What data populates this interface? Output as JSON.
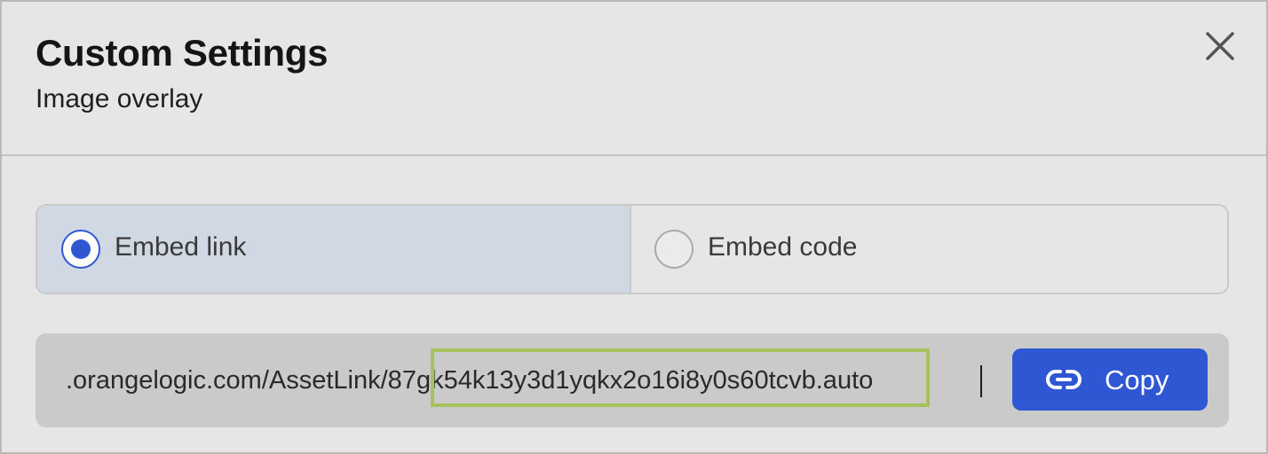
{
  "dialog": {
    "title": "Custom Settings",
    "subtitle": "Image overlay",
    "close_icon": "close-icon"
  },
  "embed_options": {
    "selected": "Embed link",
    "options": [
      {
        "label": "Embed link",
        "selected": true
      },
      {
        "label": "Embed code",
        "selected": false
      }
    ]
  },
  "link": {
    "value": ".orangelogic.com/AssetLink/87gk54k13y3d1yqkx2o16i8y0s60tcvb.auto",
    "highlighted_segment": "87gk54k13y3d1yqkx2o16i8y0s60tcvb"
  },
  "copy_button": {
    "label": "Copy",
    "icon": "link-icon"
  },
  "colors": {
    "accent": "#2f57d4",
    "selected_segment_bg": "#d0d8e4",
    "highlight_border": "#a6c25c",
    "background": "#e6e6e6"
  }
}
